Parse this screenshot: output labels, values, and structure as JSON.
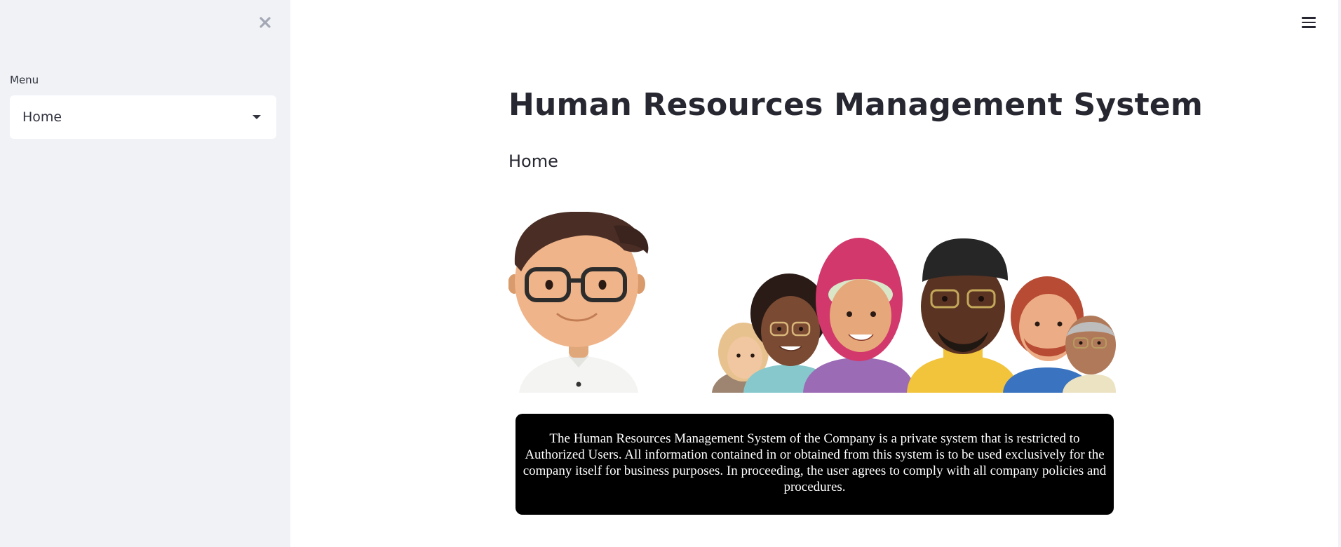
{
  "sidebar": {
    "close_icon": "close-icon",
    "menu_label": "Menu",
    "menu_select": {
      "selected": "Home",
      "caret_icon": "caret-down-icon"
    }
  },
  "header": {
    "menu_icon": "hamburger-menu-icon"
  },
  "main": {
    "title": "Human Resources Management System",
    "subtitle": "Home",
    "hero_image": "group-of-3d-cartoon-employee-avatars",
    "notice_text": "The Human Resources Management System of the Company is a private system that is restricted to Authorized Users. All information contained in or obtained from this system is to be used exclusively for the company itself for business purposes. In proceeding, the user agrees to comply with all company policies and procedures."
  },
  "colors": {
    "sidebar_bg": "#f0f2f6",
    "text": "#262730",
    "notice_bg": "#000000",
    "notice_text": "#ffffff"
  }
}
